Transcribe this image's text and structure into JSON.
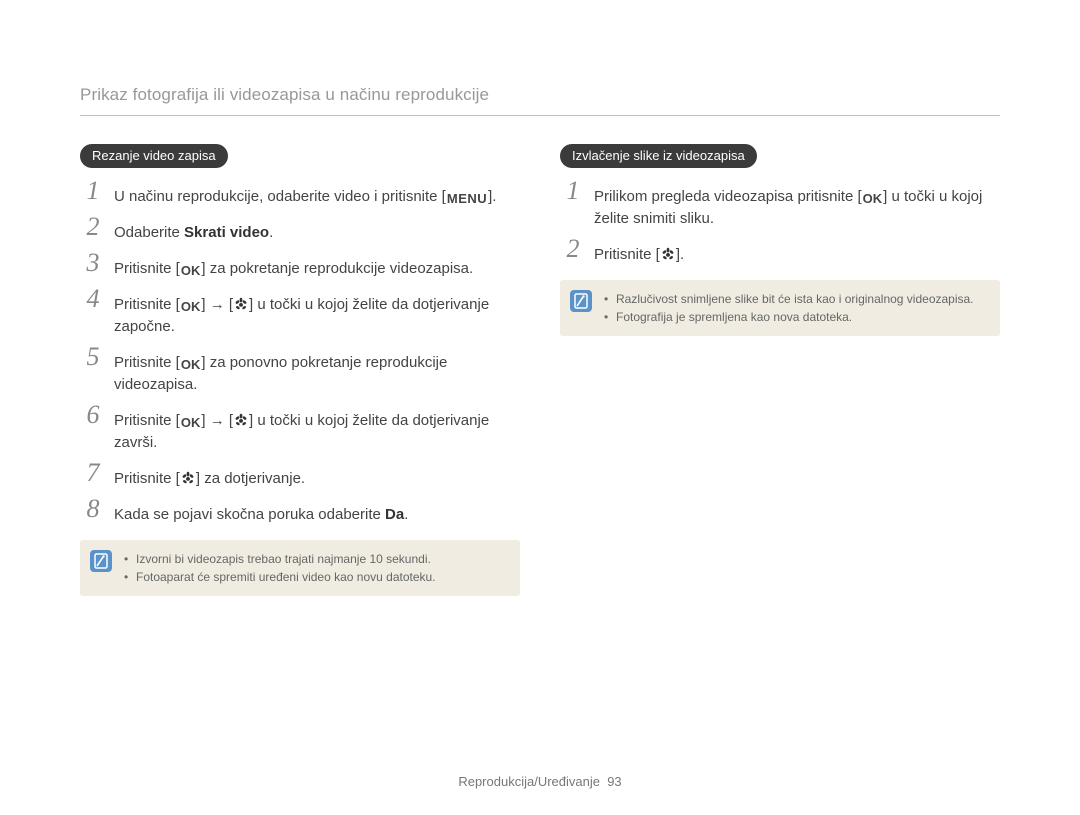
{
  "header": {
    "title": "Prikaz fotografija ili videozapisa u načinu reprodukcije"
  },
  "left": {
    "pill": "Rezanje video zapisa",
    "steps": [
      {
        "pre": "U načinu reprodukcije, odaberite video i pritisnite [",
        "icon": "menu",
        "post": "]."
      },
      {
        "pre": "Odaberite ",
        "bold": "Skrati video",
        "post2": "."
      },
      {
        "pre": "Pritisnite [",
        "icon": "ok",
        "post": "] za pokretanje reprodukcije videozapisa."
      },
      {
        "pre": "Pritisnite [",
        "icon": "ok",
        "mid": "] → [",
        "icon2": "macro",
        "post": "] u točki u kojoj želite da dotjerivanje započne."
      },
      {
        "pre": "Pritisnite [",
        "icon": "ok",
        "post": "] za ponovno pokretanje reprodukcije videozapisa."
      },
      {
        "pre": "Pritisnite [",
        "icon": "ok",
        "mid": "] → [",
        "icon2": "macro",
        "post": "] u točki u kojoj želite da dotjerivanje završi."
      },
      {
        "pre": "Pritisnite [",
        "icon": "macro",
        "post": "] za dotjerivanje."
      },
      {
        "pre": "Kada se pojavi skočna poruka odaberite ",
        "bold": "Da",
        "post2": "."
      }
    ],
    "notes": [
      "Izvorni bi videozapis trebao trajati najmanje 10 sekundi.",
      "Fotoaparat će spremiti uređeni video kao novu datoteku."
    ]
  },
  "right": {
    "pill": "Izvlačenje slike iz videozapisa",
    "steps": [
      {
        "pre": "Prilikom pregleda videozapisa pritisnite [",
        "icon": "ok",
        "post": "] u točki u kojoj želite snimiti sliku."
      },
      {
        "pre": "Pritisnite [",
        "icon": "macro",
        "post": "]."
      }
    ],
    "notes": [
      "Razlučivost snimljene slike bit će ista kao i originalnog videozapisa.",
      "Fotografija je spremljena kao nova datoteka."
    ]
  },
  "icons": {
    "menu": "MENU",
    "ok": "OK"
  },
  "footer": {
    "section": "Reprodukcija/Uređivanje",
    "page": "93"
  }
}
